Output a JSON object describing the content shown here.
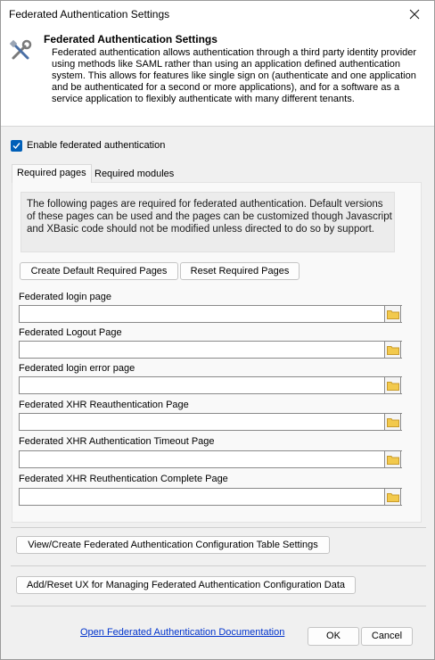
{
  "window": {
    "title": "Federated Authentication Settings"
  },
  "header": {
    "title": "Federated Authentication Settings",
    "description": "Federated authentication allows authentication through a third party identity provider using methods like SAML rather than using an application defined authentication system. This allows for features like single sign on (authenticate and one application and be authenticated for a second or more applications), and for a software as a service application to flexibly authenticate with many different tenants."
  },
  "enable": {
    "label": "Enable federated authentication",
    "checked": true
  },
  "tabs": [
    {
      "label": "Required pages",
      "active": true
    },
    {
      "label": "Required modules",
      "active": false
    }
  ],
  "required_pages": {
    "info": "The following pages are required for federated authentication. Default versions of these pages can be used and the pages can be customized though Javascript and XBasic code should not be modified unless directed to do so by support.",
    "create_default_label": "Create Default Required Pages",
    "reset_label": "Reset Required Pages",
    "fields": [
      {
        "label": "Federated login page",
        "value": ""
      },
      {
        "label": "Federated Logout Page",
        "value": ""
      },
      {
        "label": "Federated login error page",
        "value": ""
      },
      {
        "label": "Federated XHR Reauthentication Page",
        "value": ""
      },
      {
        "label": "Federated XHR Authentication Timeout Page",
        "value": ""
      },
      {
        "label": "Federated XHR Reuthentication Complete Page",
        "value": ""
      }
    ]
  },
  "actions": {
    "config_table_label": "View/Create Federated Authentication Configuration Table Settings",
    "ux_label": "Add/Reset UX for Managing Federated Authentication Configuration Data"
  },
  "footer": {
    "doc_link": "Open Federated Authentication Documentation",
    "ok_label": "OK",
    "cancel_label": "Cancel"
  },
  "colors": {
    "accent": "#005fb8",
    "link": "#0033cc",
    "folder": "#f2c94c"
  }
}
